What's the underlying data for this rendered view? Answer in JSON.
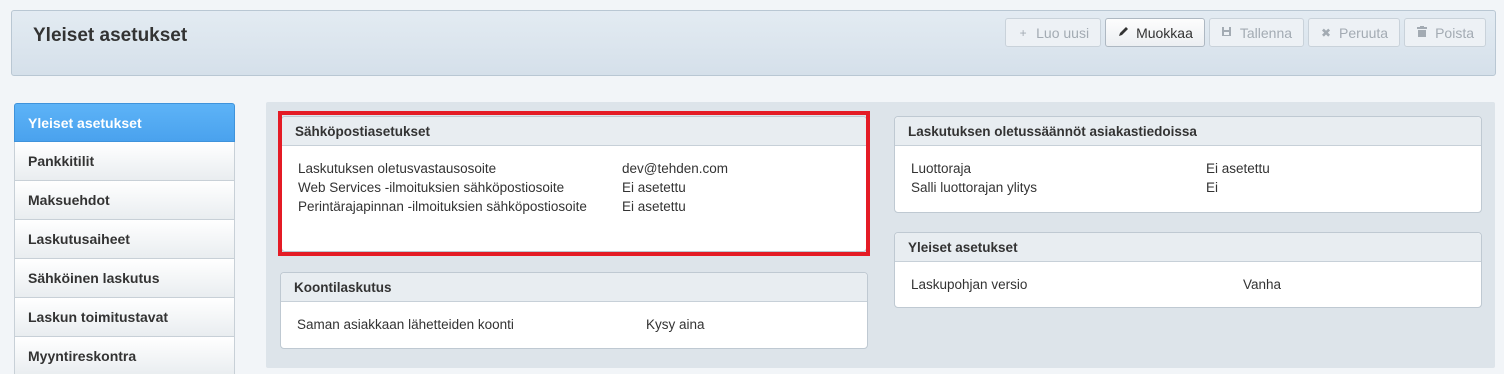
{
  "header": {
    "title": "Yleiset asetukset",
    "buttons": [
      {
        "label": "Luo uusi",
        "icon": "plus-icon"
      },
      {
        "label": "Muokkaa",
        "icon": "pencil-icon"
      },
      {
        "label": "Tallenna",
        "icon": "save-icon"
      },
      {
        "label": "Peruuta",
        "icon": "close-icon"
      },
      {
        "label": "Poista",
        "icon": "trash-icon"
      }
    ]
  },
  "sidebar": {
    "items": [
      {
        "label": "Yleiset asetukset"
      },
      {
        "label": "Pankkitilit"
      },
      {
        "label": "Maksuehdot"
      },
      {
        "label": "Laskutusaiheet"
      },
      {
        "label": "Sähköinen laskutus"
      },
      {
        "label": "Laskun toimitustavat"
      },
      {
        "label": "Myyntireskontra"
      }
    ]
  },
  "panels": {
    "email": {
      "title": "Sähköpostiasetukset",
      "rows": [
        {
          "label": "Laskutuksen oletusvastausosoite",
          "value": "dev@tehden.com"
        },
        {
          "label": "Web Services -ilmoituksien sähköpostiosoite",
          "value": "Ei asetettu"
        },
        {
          "label": "Perintärajapinnan -ilmoituksien sähköpostiosoite",
          "value": "Ei asetettu"
        }
      ]
    },
    "consolidated": {
      "title": "Koontilaskutus",
      "rows": [
        {
          "label": "Saman asiakkaan lähetteiden koonti",
          "value": "Kysy aina"
        }
      ]
    },
    "defaults": {
      "title": "Laskutuksen oletussäännöt asiakastiedoissa",
      "rows": [
        {
          "label": "Luottoraja",
          "value": "Ei asetettu"
        },
        {
          "label": "Salli luottorajan ylitys",
          "value": "Ei"
        }
      ]
    },
    "general": {
      "title": "Yleiset asetukset",
      "rows": [
        {
          "label": "Laskupohjan versio",
          "value": "Vanha"
        }
      ]
    }
  },
  "colors": {
    "accent": "#4aa2ee",
    "highlight": "#e41b25"
  }
}
